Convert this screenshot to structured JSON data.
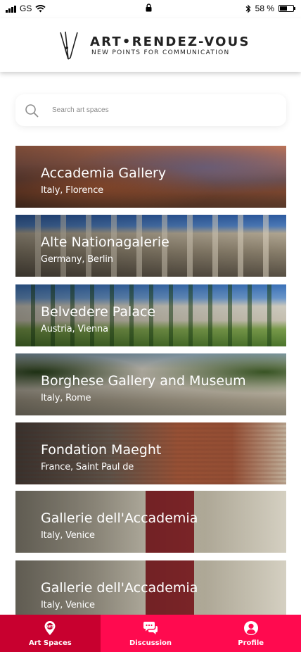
{
  "status_bar": {
    "carrier": "GS",
    "battery_text": "58 %",
    "battery_level": 0.58
  },
  "header": {
    "brand_name": "ART•RENDEZ-VOUS",
    "tagline": "NEW POINTS FOR COMMUNICATION"
  },
  "search": {
    "placeholder": "Search art spaces",
    "value": ""
  },
  "places": [
    {
      "name": "Accademia Gallery",
      "location": "Italy, Florence",
      "image_theme": "city-skyline-sunset"
    },
    {
      "name": "Alte Nationagalerie",
      "location": "Germany, Berlin",
      "image_theme": "colonnade-blue-sky"
    },
    {
      "name": "Belvedere Palace",
      "location": "Austria, Vienna",
      "image_theme": "palace-garden"
    },
    {
      "name": "Borghese Gallery and Museum",
      "location": "Italy, Rome",
      "image_theme": "villa-trees"
    },
    {
      "name": "Fondation Maeght",
      "location": "France, Saint Paul de",
      "image_theme": "modern-brick-building"
    },
    {
      "name": "Gallerie dell'Accademia",
      "location": "Italy, Venice",
      "image_theme": "facade-red-banner"
    },
    {
      "name": "Gallerie dell'Accademia",
      "location": "Italy, Venice",
      "image_theme": "facade-red-banner"
    }
  ],
  "bottom_nav": {
    "items": [
      {
        "label": "Art Spaces",
        "icon": "map-pin-icon",
        "active": true
      },
      {
        "label": "Discussion",
        "icon": "chat-bubbles-icon",
        "active": false
      },
      {
        "label": "Profile",
        "icon": "user-circle-icon",
        "active": false
      }
    ]
  },
  "colors": {
    "nav_background": "#ff0a4f",
    "nav_active_background": "#c8002f",
    "card_text": "#ffffff"
  }
}
